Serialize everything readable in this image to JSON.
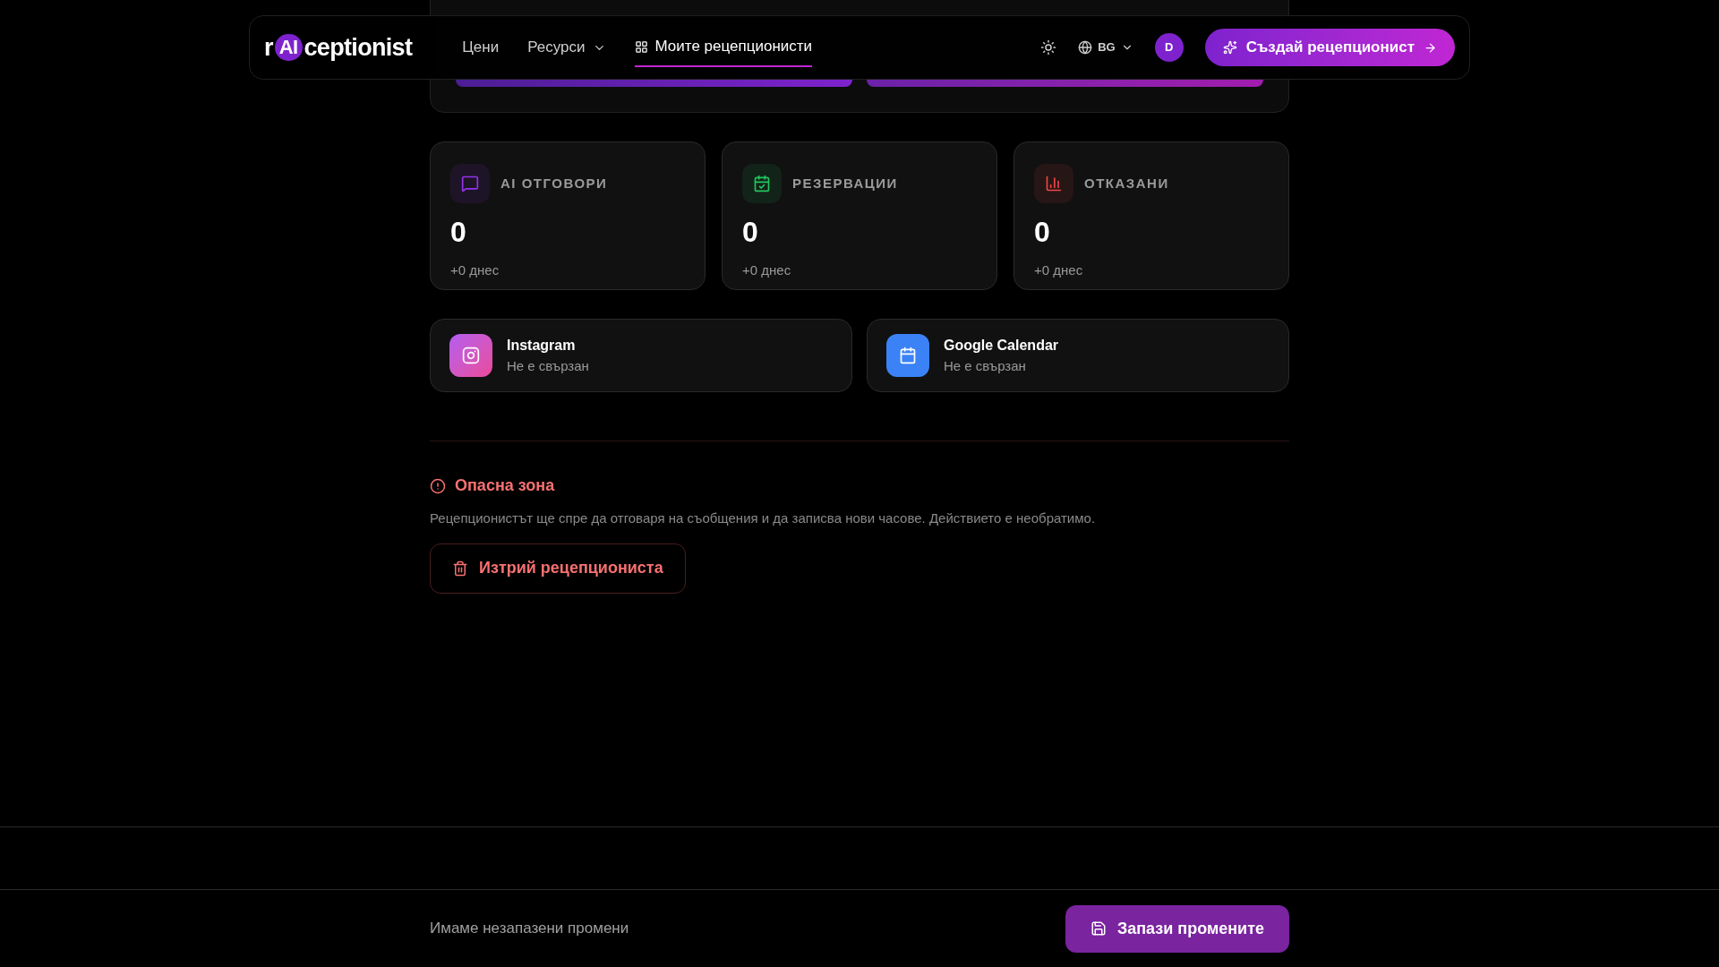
{
  "header": {
    "logo_prefix": "r",
    "logo_badge": "AI",
    "logo_suffix": "ceptionist",
    "nav": [
      {
        "label": "Цени",
        "kind": "link",
        "selected": false
      },
      {
        "label": "Ресурси",
        "kind": "dropdown",
        "selected": false
      },
      {
        "label": "Моите рецепционисти",
        "kind": "icon",
        "selected": true
      }
    ],
    "language": "BG",
    "avatar": "D",
    "cta": "Създай рецепционист"
  },
  "stats": [
    {
      "label": "AI ОТГОВОРИ",
      "value": "0",
      "delta": "+0 днес",
      "kind": "messages",
      "color": "#9333ea"
    },
    {
      "label": "РЕЗЕРВАЦИИ",
      "value": "0",
      "delta": "+0 днес",
      "kind": "bookings",
      "color": "#22c55e"
    },
    {
      "label": "ОТКАЗАНИ",
      "value": "0",
      "delta": "+0 днес",
      "kind": "declined",
      "color": "#ef4444"
    }
  ],
  "integrations": [
    {
      "name": "Instagram",
      "status": "Не е свързан",
      "kind": "instagram"
    },
    {
      "name": "Google Calendar",
      "status": "Не е свързан",
      "kind": "calendar"
    }
  ],
  "danger": {
    "title": "Опасна зона",
    "text": "Рецепционистът ще спре да отговаря на съобщения и да записва нови часове. Действието е необратимо.",
    "button": "Изтрий рецепциониста"
  },
  "footer": {
    "message": "Имаме незапазени промени",
    "save": "Запази промените"
  }
}
